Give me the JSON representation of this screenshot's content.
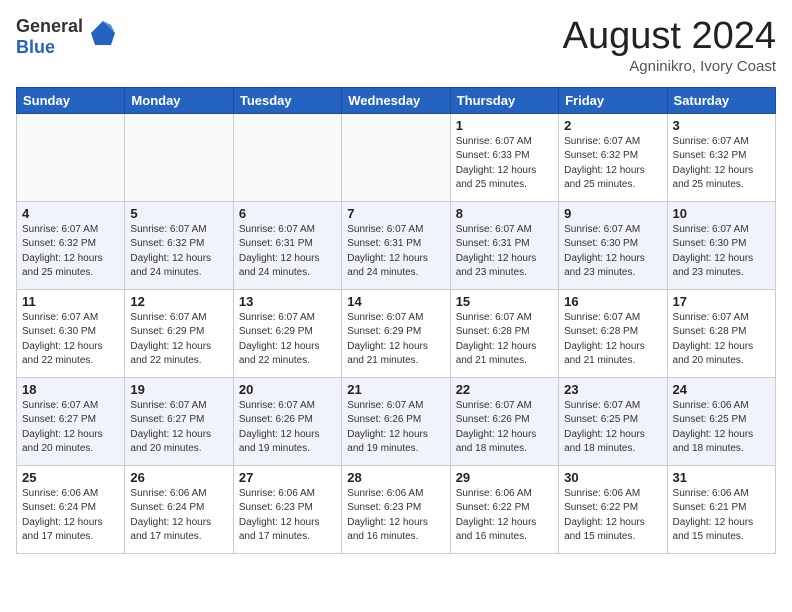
{
  "header": {
    "logo_line1": "General",
    "logo_line2": "Blue",
    "month_year": "August 2024",
    "location": "Agninikro, Ivory Coast"
  },
  "weekdays": [
    "Sunday",
    "Monday",
    "Tuesday",
    "Wednesday",
    "Thursday",
    "Friday",
    "Saturday"
  ],
  "weeks": [
    [
      {
        "day": "",
        "info": ""
      },
      {
        "day": "",
        "info": ""
      },
      {
        "day": "",
        "info": ""
      },
      {
        "day": "",
        "info": ""
      },
      {
        "day": "1",
        "info": "Sunrise: 6:07 AM\nSunset: 6:33 PM\nDaylight: 12 hours\nand 25 minutes."
      },
      {
        "day": "2",
        "info": "Sunrise: 6:07 AM\nSunset: 6:32 PM\nDaylight: 12 hours\nand 25 minutes."
      },
      {
        "day": "3",
        "info": "Sunrise: 6:07 AM\nSunset: 6:32 PM\nDaylight: 12 hours\nand 25 minutes."
      }
    ],
    [
      {
        "day": "4",
        "info": "Sunrise: 6:07 AM\nSunset: 6:32 PM\nDaylight: 12 hours\nand 25 minutes."
      },
      {
        "day": "5",
        "info": "Sunrise: 6:07 AM\nSunset: 6:32 PM\nDaylight: 12 hours\nand 24 minutes."
      },
      {
        "day": "6",
        "info": "Sunrise: 6:07 AM\nSunset: 6:31 PM\nDaylight: 12 hours\nand 24 minutes."
      },
      {
        "day": "7",
        "info": "Sunrise: 6:07 AM\nSunset: 6:31 PM\nDaylight: 12 hours\nand 24 minutes."
      },
      {
        "day": "8",
        "info": "Sunrise: 6:07 AM\nSunset: 6:31 PM\nDaylight: 12 hours\nand 23 minutes."
      },
      {
        "day": "9",
        "info": "Sunrise: 6:07 AM\nSunset: 6:30 PM\nDaylight: 12 hours\nand 23 minutes."
      },
      {
        "day": "10",
        "info": "Sunrise: 6:07 AM\nSunset: 6:30 PM\nDaylight: 12 hours\nand 23 minutes."
      }
    ],
    [
      {
        "day": "11",
        "info": "Sunrise: 6:07 AM\nSunset: 6:30 PM\nDaylight: 12 hours\nand 22 minutes."
      },
      {
        "day": "12",
        "info": "Sunrise: 6:07 AM\nSunset: 6:29 PM\nDaylight: 12 hours\nand 22 minutes."
      },
      {
        "day": "13",
        "info": "Sunrise: 6:07 AM\nSunset: 6:29 PM\nDaylight: 12 hours\nand 22 minutes."
      },
      {
        "day": "14",
        "info": "Sunrise: 6:07 AM\nSunset: 6:29 PM\nDaylight: 12 hours\nand 21 minutes."
      },
      {
        "day": "15",
        "info": "Sunrise: 6:07 AM\nSunset: 6:28 PM\nDaylight: 12 hours\nand 21 minutes."
      },
      {
        "day": "16",
        "info": "Sunrise: 6:07 AM\nSunset: 6:28 PM\nDaylight: 12 hours\nand 21 minutes."
      },
      {
        "day": "17",
        "info": "Sunrise: 6:07 AM\nSunset: 6:28 PM\nDaylight: 12 hours\nand 20 minutes."
      }
    ],
    [
      {
        "day": "18",
        "info": "Sunrise: 6:07 AM\nSunset: 6:27 PM\nDaylight: 12 hours\nand 20 minutes."
      },
      {
        "day": "19",
        "info": "Sunrise: 6:07 AM\nSunset: 6:27 PM\nDaylight: 12 hours\nand 20 minutes."
      },
      {
        "day": "20",
        "info": "Sunrise: 6:07 AM\nSunset: 6:26 PM\nDaylight: 12 hours\nand 19 minutes."
      },
      {
        "day": "21",
        "info": "Sunrise: 6:07 AM\nSunset: 6:26 PM\nDaylight: 12 hours\nand 19 minutes."
      },
      {
        "day": "22",
        "info": "Sunrise: 6:07 AM\nSunset: 6:26 PM\nDaylight: 12 hours\nand 18 minutes."
      },
      {
        "day": "23",
        "info": "Sunrise: 6:07 AM\nSunset: 6:25 PM\nDaylight: 12 hours\nand 18 minutes."
      },
      {
        "day": "24",
        "info": "Sunrise: 6:06 AM\nSunset: 6:25 PM\nDaylight: 12 hours\nand 18 minutes."
      }
    ],
    [
      {
        "day": "25",
        "info": "Sunrise: 6:06 AM\nSunset: 6:24 PM\nDaylight: 12 hours\nand 17 minutes."
      },
      {
        "day": "26",
        "info": "Sunrise: 6:06 AM\nSunset: 6:24 PM\nDaylight: 12 hours\nand 17 minutes."
      },
      {
        "day": "27",
        "info": "Sunrise: 6:06 AM\nSunset: 6:23 PM\nDaylight: 12 hours\nand 17 minutes."
      },
      {
        "day": "28",
        "info": "Sunrise: 6:06 AM\nSunset: 6:23 PM\nDaylight: 12 hours\nand 16 minutes."
      },
      {
        "day": "29",
        "info": "Sunrise: 6:06 AM\nSunset: 6:22 PM\nDaylight: 12 hours\nand 16 minutes."
      },
      {
        "day": "30",
        "info": "Sunrise: 6:06 AM\nSunset: 6:22 PM\nDaylight: 12 hours\nand 15 minutes."
      },
      {
        "day": "31",
        "info": "Sunrise: 6:06 AM\nSunset: 6:21 PM\nDaylight: 12 hours\nand 15 minutes."
      }
    ]
  ]
}
